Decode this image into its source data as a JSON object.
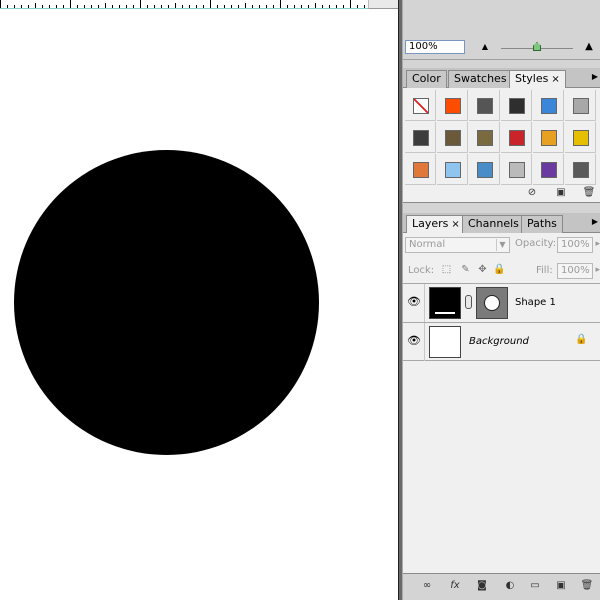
{
  "navigator": {
    "zoom_value": "100%"
  },
  "styles_tabs": [
    {
      "label": "Color"
    },
    {
      "label": "Swatches"
    },
    {
      "label": "Styles",
      "close": "×"
    }
  ],
  "styles_swatches": [
    {
      "name": "no-style",
      "color": "#ffffff"
    },
    {
      "name": "red-glow",
      "color": "#ff4d00"
    },
    {
      "name": "gray-bevel",
      "color": "#555555"
    },
    {
      "name": "chrome",
      "color": "#2e2e2e"
    },
    {
      "name": "blue-glass",
      "color": "#3a86d8"
    },
    {
      "name": "light-gray",
      "color": "#a8a8a8"
    },
    {
      "name": "dark-metal",
      "color": "#3c3c3c"
    },
    {
      "name": "bronze",
      "color": "#6b5a3a"
    },
    {
      "name": "olive-bronze",
      "color": "#7a6a40"
    },
    {
      "name": "red-stripes",
      "color": "#c8242a"
    },
    {
      "name": "rainbow",
      "color": "#e8a020"
    },
    {
      "name": "yellow",
      "color": "#e5c000"
    },
    {
      "name": "orange-gradient",
      "color": "#e0783c"
    },
    {
      "name": "sky-blue",
      "color": "#8ec4ee"
    },
    {
      "name": "sunset-sky",
      "color": "#4a8cc8"
    },
    {
      "name": "mosaic",
      "color": "#bababa"
    },
    {
      "name": "purple",
      "color": "#6a3aa0"
    },
    {
      "name": "gray-button",
      "color": "#5a5a5a"
    }
  ],
  "layers_tabs": [
    {
      "label": "Layers",
      "close": "×"
    },
    {
      "label": "Channels"
    },
    {
      "label": "Paths"
    }
  ],
  "layers_controls": {
    "blend_mode": "Normal",
    "opacity_label": "Opacity:",
    "opacity_value": "100%",
    "lock_label": "Lock:",
    "fill_label": "Fill:",
    "fill_value": "100%"
  },
  "layers": [
    {
      "name": "Shape 1"
    },
    {
      "name": "Background"
    }
  ]
}
